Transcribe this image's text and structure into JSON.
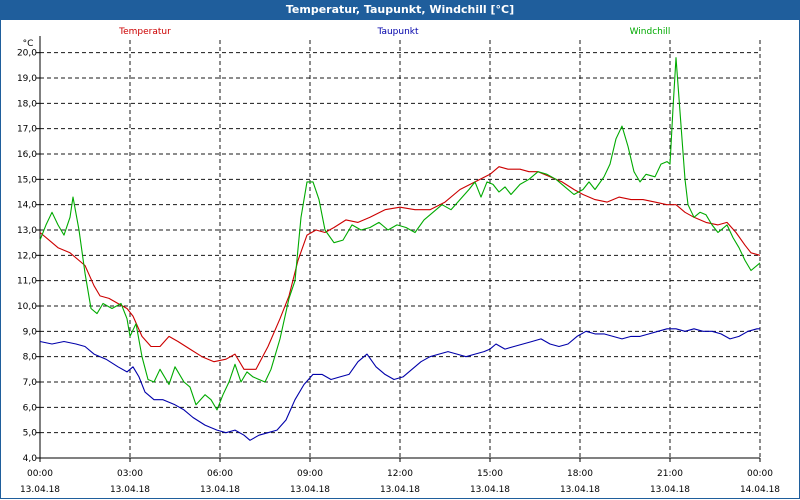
{
  "window": {
    "title": "Temperatur, Taupunkt, Windchill [°C]"
  },
  "chart_data": {
    "type": "line",
    "title": "Temperatur, Taupunkt, Windchill [°C]",
    "ylabel": "°C",
    "xlabel": "",
    "ylim": [
      4.0,
      20.5
    ],
    "xlim": [
      0,
      24
    ],
    "grid": true,
    "legend_placement": "top",
    "y_ticks": [
      "4,0",
      "5,0",
      "6,0",
      "7,0",
      "8,0",
      "9,0",
      "10,0",
      "11,0",
      "12,0",
      "13,0",
      "14,0",
      "15,0",
      "16,0",
      "17,0",
      "18,0",
      "19,0",
      "20,0"
    ],
    "x_ticks": [
      {
        "time": "00:00",
        "date": "13.04.18"
      },
      {
        "time": "03:00",
        "date": "13.04.18"
      },
      {
        "time": "06:00",
        "date": "13.04.18"
      },
      {
        "time": "09:00",
        "date": "13.04.18"
      },
      {
        "time": "12:00",
        "date": "13.04.18"
      },
      {
        "time": "15:00",
        "date": "13.04.18"
      },
      {
        "time": "18:00",
        "date": "13.04.18"
      },
      {
        "time": "21:00",
        "date": "13.04.18"
      },
      {
        "time": "00:00",
        "date": "14.04.18"
      }
    ],
    "series": [
      {
        "name": "Temperatur",
        "color": "#cc0000",
        "points": [
          [
            0,
            12.9
          ],
          [
            0.3,
            12.6
          ],
          [
            0.6,
            12.3
          ],
          [
            1.0,
            12.1
          ],
          [
            1.5,
            11.6
          ],
          [
            1.8,
            10.8
          ],
          [
            2.0,
            10.4
          ],
          [
            2.3,
            10.3
          ],
          [
            2.6,
            10.1
          ],
          [
            2.9,
            9.9
          ],
          [
            3.1,
            9.6
          ],
          [
            3.4,
            8.8
          ],
          [
            3.7,
            8.4
          ],
          [
            4.0,
            8.4
          ],
          [
            4.3,
            8.8
          ],
          [
            4.6,
            8.6
          ],
          [
            5.0,
            8.3
          ],
          [
            5.4,
            8.0
          ],
          [
            5.8,
            7.8
          ],
          [
            6.2,
            7.9
          ],
          [
            6.5,
            8.1
          ],
          [
            6.8,
            7.5
          ],
          [
            7.2,
            7.5
          ],
          [
            7.6,
            8.4
          ],
          [
            8.0,
            9.5
          ],
          [
            8.3,
            10.4
          ],
          [
            8.6,
            11.8
          ],
          [
            8.9,
            12.8
          ],
          [
            9.2,
            13.0
          ],
          [
            9.5,
            12.9
          ],
          [
            9.8,
            13.1
          ],
          [
            10.2,
            13.4
          ],
          [
            10.6,
            13.3
          ],
          [
            11.0,
            13.5
          ],
          [
            11.5,
            13.8
          ],
          [
            12.0,
            13.9
          ],
          [
            12.5,
            13.8
          ],
          [
            13.0,
            13.8
          ],
          [
            13.5,
            14.1
          ],
          [
            14.0,
            14.6
          ],
          [
            14.5,
            14.9
          ],
          [
            15.0,
            15.2
          ],
          [
            15.3,
            15.5
          ],
          [
            15.6,
            15.4
          ],
          [
            16.0,
            15.4
          ],
          [
            16.3,
            15.3
          ],
          [
            16.6,
            15.3
          ],
          [
            17.0,
            15.1
          ],
          [
            17.4,
            14.9
          ],
          [
            17.8,
            14.6
          ],
          [
            18.1,
            14.4
          ],
          [
            18.5,
            14.2
          ],
          [
            18.9,
            14.1
          ],
          [
            19.3,
            14.3
          ],
          [
            19.7,
            14.2
          ],
          [
            20.1,
            14.2
          ],
          [
            20.5,
            14.1
          ],
          [
            20.9,
            14.0
          ],
          [
            21.2,
            14.0
          ],
          [
            21.5,
            13.7
          ],
          [
            21.8,
            13.5
          ],
          [
            22.2,
            13.3
          ],
          [
            22.6,
            13.2
          ],
          [
            22.9,
            13.3
          ],
          [
            23.2,
            12.9
          ],
          [
            23.5,
            12.4
          ],
          [
            23.7,
            12.1
          ],
          [
            24.0,
            12.0
          ]
        ]
      },
      {
        "name": "Taupunkt",
        "color": "#0000aa",
        "points": [
          [
            0,
            8.6
          ],
          [
            0.4,
            8.5
          ],
          [
            0.8,
            8.6
          ],
          [
            1.2,
            8.5
          ],
          [
            1.5,
            8.4
          ],
          [
            1.8,
            8.1
          ],
          [
            2.2,
            7.9
          ],
          [
            2.6,
            7.6
          ],
          [
            2.9,
            7.4
          ],
          [
            3.1,
            7.6
          ],
          [
            3.3,
            7.2
          ],
          [
            3.5,
            6.6
          ],
          [
            3.8,
            6.3
          ],
          [
            4.1,
            6.3
          ],
          [
            4.5,
            6.1
          ],
          [
            4.8,
            5.9
          ],
          [
            5.1,
            5.6
          ],
          [
            5.5,
            5.3
          ],
          [
            5.9,
            5.1
          ],
          [
            6.2,
            5.0
          ],
          [
            6.5,
            5.1
          ],
          [
            6.8,
            4.9
          ],
          [
            7.0,
            4.7
          ],
          [
            7.3,
            4.9
          ],
          [
            7.6,
            5.0
          ],
          [
            7.9,
            5.1
          ],
          [
            8.2,
            5.5
          ],
          [
            8.5,
            6.3
          ],
          [
            8.8,
            6.9
          ],
          [
            9.1,
            7.3
          ],
          [
            9.4,
            7.3
          ],
          [
            9.7,
            7.1
          ],
          [
            10.0,
            7.2
          ],
          [
            10.3,
            7.3
          ],
          [
            10.6,
            7.8
          ],
          [
            10.9,
            8.1
          ],
          [
            11.2,
            7.6
          ],
          [
            11.5,
            7.3
          ],
          [
            11.8,
            7.1
          ],
          [
            12.1,
            7.2
          ],
          [
            12.4,
            7.5
          ],
          [
            12.7,
            7.8
          ],
          [
            13.0,
            8.0
          ],
          [
            13.3,
            8.1
          ],
          [
            13.6,
            8.2
          ],
          [
            13.9,
            8.1
          ],
          [
            14.2,
            8.0
          ],
          [
            14.5,
            8.1
          ],
          [
            14.8,
            8.2
          ],
          [
            15.0,
            8.3
          ],
          [
            15.2,
            8.5
          ],
          [
            15.5,
            8.3
          ],
          [
            15.8,
            8.4
          ],
          [
            16.1,
            8.5
          ],
          [
            16.4,
            8.6
          ],
          [
            16.7,
            8.7
          ],
          [
            17.0,
            8.5
          ],
          [
            17.3,
            8.4
          ],
          [
            17.6,
            8.5
          ],
          [
            17.9,
            8.8
          ],
          [
            18.2,
            9.0
          ],
          [
            18.5,
            8.9
          ],
          [
            18.8,
            8.9
          ],
          [
            19.1,
            8.8
          ],
          [
            19.4,
            8.7
          ],
          [
            19.7,
            8.8
          ],
          [
            20.0,
            8.8
          ],
          [
            20.3,
            8.9
          ],
          [
            20.6,
            9.0
          ],
          [
            20.9,
            9.1
          ],
          [
            21.2,
            9.1
          ],
          [
            21.5,
            9.0
          ],
          [
            21.8,
            9.1
          ],
          [
            22.1,
            9.0
          ],
          [
            22.4,
            9.0
          ],
          [
            22.7,
            8.9
          ],
          [
            23.0,
            8.7
          ],
          [
            23.3,
            8.8
          ],
          [
            23.6,
            9.0
          ],
          [
            23.9,
            9.1
          ],
          [
            24.0,
            9.1
          ]
        ]
      },
      {
        "name": "Windchill",
        "color": "#00aa00",
        "points": [
          [
            0,
            12.6
          ],
          [
            0.2,
            13.2
          ],
          [
            0.4,
            13.7
          ],
          [
            0.6,
            13.2
          ],
          [
            0.8,
            12.8
          ],
          [
            1.0,
            13.5
          ],
          [
            1.1,
            14.3
          ],
          [
            1.3,
            13.0
          ],
          [
            1.5,
            11.3
          ],
          [
            1.7,
            9.9
          ],
          [
            1.9,
            9.7
          ],
          [
            2.1,
            10.1
          ],
          [
            2.4,
            9.9
          ],
          [
            2.7,
            10.1
          ],
          [
            2.9,
            9.5
          ],
          [
            3.0,
            8.8
          ],
          [
            3.2,
            9.3
          ],
          [
            3.4,
            8.0
          ],
          [
            3.6,
            7.1
          ],
          [
            3.8,
            7.0
          ],
          [
            4.0,
            7.5
          ],
          [
            4.3,
            6.9
          ],
          [
            4.5,
            7.6
          ],
          [
            4.8,
            7.0
          ],
          [
            5.0,
            6.8
          ],
          [
            5.2,
            6.1
          ],
          [
            5.5,
            6.5
          ],
          [
            5.7,
            6.3
          ],
          [
            5.9,
            5.9
          ],
          [
            6.1,
            6.5
          ],
          [
            6.3,
            7.0
          ],
          [
            6.5,
            7.7
          ],
          [
            6.7,
            7.0
          ],
          [
            6.9,
            7.4
          ],
          [
            7.1,
            7.2
          ],
          [
            7.3,
            7.1
          ],
          [
            7.5,
            7.0
          ],
          [
            7.7,
            7.5
          ],
          [
            8.0,
            8.7
          ],
          [
            8.3,
            10.3
          ],
          [
            8.5,
            11.0
          ],
          [
            8.7,
            13.5
          ],
          [
            8.9,
            14.9
          ],
          [
            9.1,
            14.9
          ],
          [
            9.3,
            14.2
          ],
          [
            9.5,
            13.0
          ],
          [
            9.8,
            12.5
          ],
          [
            10.1,
            12.6
          ],
          [
            10.4,
            13.2
          ],
          [
            10.7,
            13.0
          ],
          [
            11.0,
            13.1
          ],
          [
            11.3,
            13.3
          ],
          [
            11.6,
            13.0
          ],
          [
            11.9,
            13.2
          ],
          [
            12.2,
            13.1
          ],
          [
            12.5,
            12.9
          ],
          [
            12.8,
            13.4
          ],
          [
            13.1,
            13.7
          ],
          [
            13.4,
            14.0
          ],
          [
            13.7,
            13.8
          ],
          [
            14.0,
            14.2
          ],
          [
            14.3,
            14.6
          ],
          [
            14.5,
            14.9
          ],
          [
            14.7,
            14.3
          ],
          [
            14.9,
            14.9
          ],
          [
            15.1,
            14.8
          ],
          [
            15.3,
            14.5
          ],
          [
            15.5,
            14.7
          ],
          [
            15.7,
            14.4
          ],
          [
            16.0,
            14.8
          ],
          [
            16.3,
            15.0
          ],
          [
            16.6,
            15.3
          ],
          [
            16.9,
            15.2
          ],
          [
            17.2,
            15.0
          ],
          [
            17.5,
            14.7
          ],
          [
            17.8,
            14.4
          ],
          [
            18.1,
            14.6
          ],
          [
            18.3,
            14.9
          ],
          [
            18.5,
            14.6
          ],
          [
            18.8,
            15.1
          ],
          [
            19.0,
            15.6
          ],
          [
            19.2,
            16.6
          ],
          [
            19.4,
            17.1
          ],
          [
            19.6,
            16.3
          ],
          [
            19.8,
            15.3
          ],
          [
            20.0,
            14.9
          ],
          [
            20.2,
            15.2
          ],
          [
            20.5,
            15.1
          ],
          [
            20.7,
            15.6
          ],
          [
            20.9,
            15.7
          ],
          [
            21.0,
            15.6
          ],
          [
            21.1,
            17.8
          ],
          [
            21.2,
            19.8
          ],
          [
            21.3,
            18.2
          ],
          [
            21.4,
            16.6
          ],
          [
            21.5,
            15.0
          ],
          [
            21.6,
            14.0
          ],
          [
            21.8,
            13.5
          ],
          [
            22.0,
            13.7
          ],
          [
            22.2,
            13.6
          ],
          [
            22.4,
            13.2
          ],
          [
            22.6,
            12.9
          ],
          [
            22.9,
            13.2
          ],
          [
            23.1,
            12.7
          ],
          [
            23.3,
            12.3
          ],
          [
            23.5,
            11.8
          ],
          [
            23.7,
            11.4
          ],
          [
            24.0,
            11.7
          ]
        ]
      }
    ]
  }
}
